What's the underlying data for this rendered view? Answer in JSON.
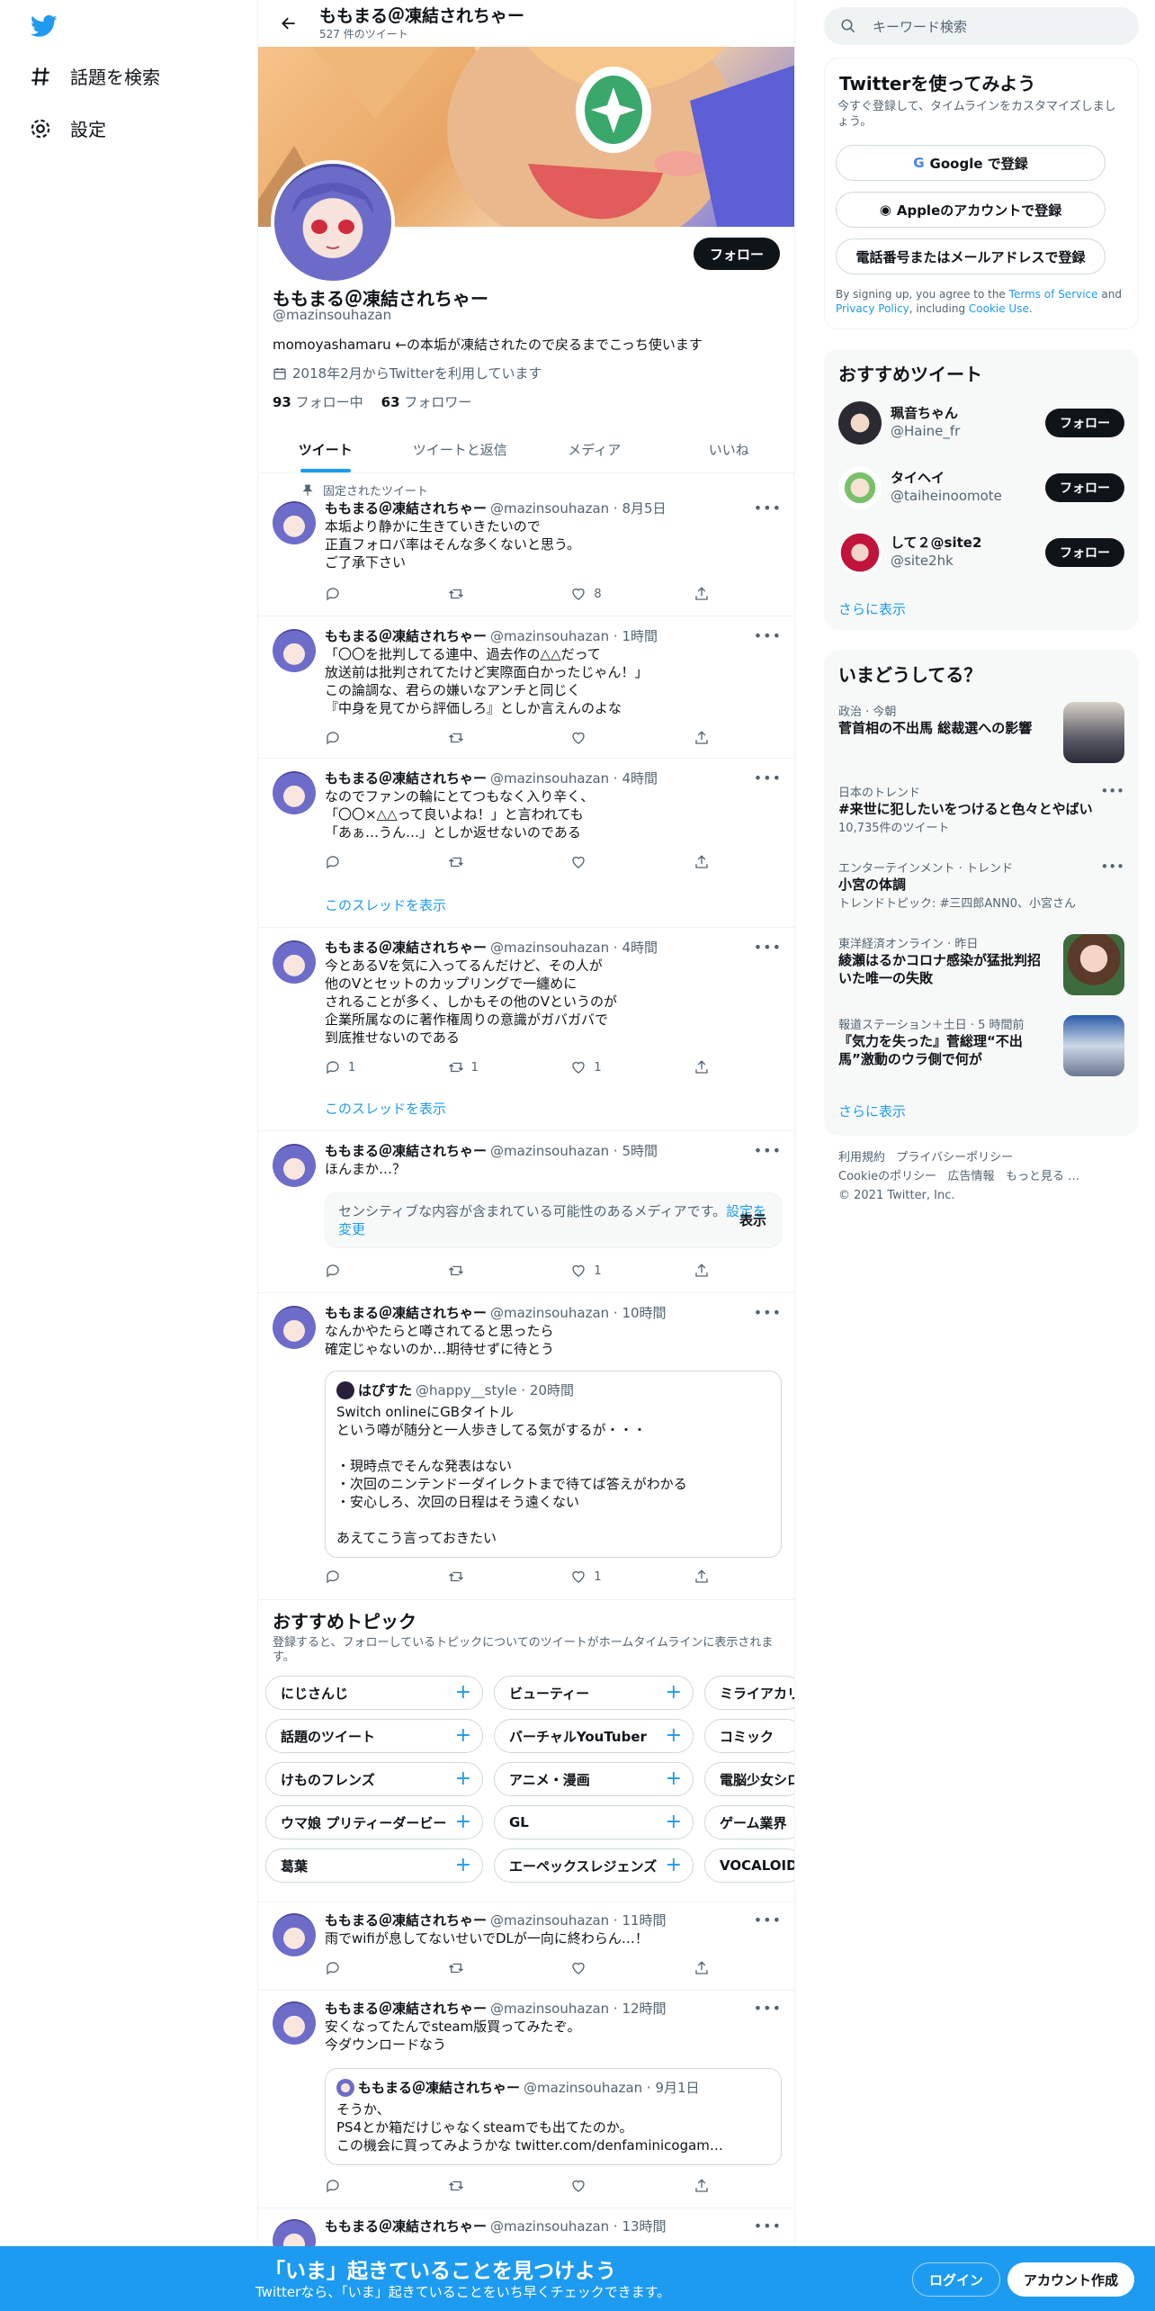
{
  "nav": {
    "explore": "話題を検索",
    "settings": "設定"
  },
  "header": {
    "title": "ももまる＠凍結されちゃー",
    "tweet_count": "527 件のツイート"
  },
  "profile": {
    "name": "ももまる＠凍結されちゃー",
    "handle": "@mazinsouhazan",
    "bio": "momoyashamaru ←の本垢が凍結されたので戻るまでこっち使います",
    "joined": "2018年2月からTwitterを利用しています",
    "following_count": "93",
    "following_label": "フォロー中",
    "followers_count": "63",
    "followers_label": "フォロワー",
    "follow_button": "フォロー"
  },
  "tabs": [
    "ツイート",
    "ツイートと返信",
    "メディア",
    "いいね"
  ],
  "pinned_label": "固定されたツイート",
  "thread_link": "このスレッドを表示",
  "tweets": [
    {
      "name": "ももまる＠凍結されちゃー",
      "meta": "@mazinsouhazan · 8月5日",
      "text": "本垢より静かに生きていきたいので\n正直フォロバ率はそんな多くないと思う。\nご了承下さい",
      "reply": "",
      "rt": "",
      "like": "8"
    },
    {
      "name": "ももまる＠凍結されちゃー",
      "meta": "@mazinsouhazan · 1時間",
      "text": "「〇〇を批判してる連中、過去作の△△だって\n放送前は批判されてたけど実際面白かったじゃん！」\nこの論調な、君らの嫌いなアンチと同じく\n『中身を見てから評価しろ』としか言えんのよな",
      "reply": "",
      "rt": "",
      "like": ""
    },
    {
      "name": "ももまる＠凍結されちゃー",
      "meta": "@mazinsouhazan · 4時間",
      "text": "なのでファンの輪にとてつもなく入り辛く、\n「〇〇×△△って良いよね！」と言われても\n「あぁ…うん…」としか返せないのである",
      "reply": "",
      "rt": "",
      "like": ""
    },
    {
      "name": "ももまる＠凍結されちゃー",
      "meta": "@mazinsouhazan · 4時間",
      "text": "今とあるVを気に入ってるんだけど、その人が\n他のVとセットのカップリングで一纏めに\nされることが多く、しかもその他のVというのが\n企業所属なのに著作権周りの意識がガバガバで\n到底推せないのである",
      "reply": "1",
      "rt": "1",
      "like": "1"
    },
    {
      "name": "ももまる＠凍結されちゃー",
      "meta": "@mazinsouhazan · 5時間",
      "text": "ほんまか…？",
      "reply": "",
      "rt": "",
      "like": "1"
    },
    {
      "name": "ももまる＠凍結されちゃー",
      "meta": "@mazinsouhazan · 10時間",
      "text": "なんかやたらと噂されてると思ったら\n確定じゃないのか…期待せずに待とう",
      "reply": "",
      "rt": "",
      "like": "1"
    },
    {
      "name": "ももまる＠凍結されちゃー",
      "meta": "@mazinsouhazan · 11時間",
      "text": "雨でwifiが息してないせいでDLが一向に終わらん…！",
      "reply": "",
      "rt": "",
      "like": ""
    },
    {
      "name": "ももまる＠凍結されちゃー",
      "meta": "@mazinsouhazan · 12時間",
      "text": "安くなってたんでsteam版買ってみたぞ。\n今ダウンロードなう",
      "reply": "",
      "rt": "",
      "like": ""
    },
    {
      "name": "ももまる＠凍結されちゃー",
      "meta": "@mazinsouhazan · 13時間",
      "text": "",
      "reply": "",
      "rt": "",
      "like": ""
    }
  ],
  "sensitive": {
    "text": "センシティブな内容が含まれている可能性のあるメディアです。",
    "link": "設定を変更",
    "show": "表示"
  },
  "quote1": {
    "name": "はぴすた",
    "meta": "@happy__style · 20時間",
    "text": "Switch onlineにGBタイトル\nという噂が随分と一人歩きしてる気がするが・・・\n\n・現時点でそんな発表はない\n・次回のニンテンドーダイレクトまで待てば答えがわかる\n・安心しろ、次回の日程はそう遠くない\n\nあえてこう言っておきたい"
  },
  "quote2": {
    "name": "ももまる＠凍結されちゃー",
    "meta": "@mazinsouhazan · 9月1日",
    "text": "そうか、\nPS4とか箱だけじゃなくsteamでも出てたのか。\nこの機会に買ってみようかな twitter.com/denfaminicogam…"
  },
  "topics": {
    "title": "おすすめトピック",
    "desc": "登録すると、フォローしているトピックについてのツイートがホームタイムラインに表示されます。",
    "chips": [
      [
        "にじさんじ",
        "ビューティー",
        "ミライアカリ"
      ],
      [
        "話題のツイート",
        "バーチャルYouTuber",
        "コミック"
      ],
      [
        "けものフレンズ",
        "アニメ・漫画",
        "電脳少女シロ"
      ],
      [
        "ウマ娘 プリティーダービー",
        "GL",
        "ゲーム業界"
      ],
      [
        "葛葉",
        "エーペックスレジェンズ",
        "VOCALOID"
      ]
    ]
  },
  "search": {
    "placeholder": "キーワード検索"
  },
  "signup": {
    "title": "Twitterを使ってみよう",
    "sub": "今すぐ登録して、タイムラインをカスタマイズしましょう。",
    "google": "Google で登録",
    "apple": "Appleのアカウントで登録",
    "phone": "電話番号またはメールアドレスで登録",
    "terms_prefix": "By signing up, you agree to the",
    "terms": "Terms of Service",
    "and": "and",
    "privacy": "Privacy Policy",
    "including": ", including",
    "cookie": "Cookie Use",
    "period": "."
  },
  "recommend": {
    "title": "おすすめツイート",
    "users": [
      {
        "name": "珮音ちゃん",
        "handle": "@Haine_fr",
        "button": "フォロー"
      },
      {
        "name": "タイヘイ",
        "handle": "@taiheinoomote",
        "button": "フォロー"
      },
      {
        "name": "して２@site2",
        "handle": "@site2hk",
        "button": "フォロー"
      }
    ],
    "more": "さらに表示"
  },
  "trends": {
    "title": "いまどうしてる？",
    "items": [
      {
        "cat": "政治 · 今朝",
        "title": "菅首相の不出馬 総裁選への影響",
        "extra": ""
      },
      {
        "cat": "日本のトレンド",
        "title": "#来世に犯したいをつけると色々とやばい",
        "extra": "10,735件のツイート"
      },
      {
        "cat": "エンターテインメント · トレンド",
        "title": "小宮の体調",
        "extra": "トレンドトピック: #三四郎ANN0、小宮さん"
      },
      {
        "cat": "東洋経済オンライン · 昨日",
        "title": "綾瀬はるかコロナ感染が猛批判招いた唯一の失敗",
        "extra": ""
      },
      {
        "cat": "報道ステーション＋土日 · 5 時間前",
        "title": "『気力を失った』菅総理“不出馬”激動のウラ側で何が",
        "extra": ""
      }
    ],
    "more": "さらに表示"
  },
  "footer": {
    "terms": "利用規約",
    "privacy": "プライバシーポリシー",
    "cookie": "Cookieのポリシー",
    "ads": "広告情報",
    "more": "もっと見る …",
    "copyright": "© 2021 Twitter, Inc."
  },
  "bottom": {
    "headline": "「いま」起きていることを見つけよう",
    "sub": "Twitterなら、「いま」起きていることをいち早くチェックできます。",
    "login": "ログイン",
    "signup": "アカウント作成"
  },
  "colors": {
    "accent": "#1d9bf0",
    "text": "#0f1419",
    "muted": "#536471"
  }
}
